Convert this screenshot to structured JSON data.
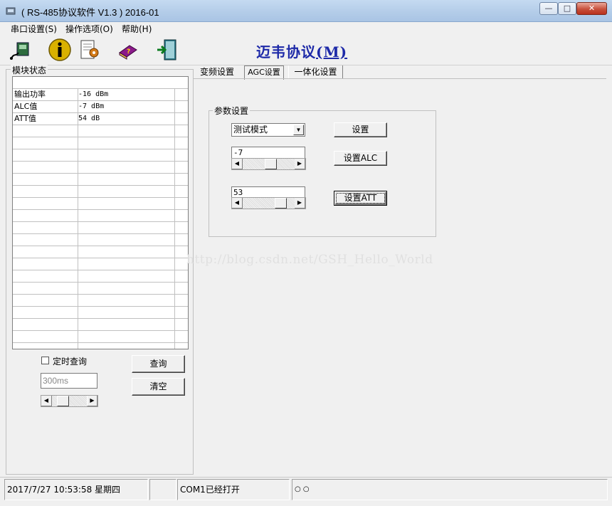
{
  "window": {
    "title": "( RS-485协议软件 V1.3 ) 2016-01",
    "minimize": "—",
    "maximize": "□",
    "close": "✕"
  },
  "menu": [
    "串口设置(S)",
    "操作选项(O)",
    "帮助(H)"
  ],
  "toolbar": {
    "icons": [
      "serial-port-icon",
      "info-icon",
      "settings-icon",
      "help-book-icon",
      "exit-door-icon"
    ],
    "brand": "迈韦协议",
    "brand_m": "(M)"
  },
  "module_status": {
    "title": "模块状态",
    "rows": [
      {
        "name": "输出功率",
        "value": "-16 dBm"
      },
      {
        "name": "ALC值",
        "value": "-7 dBm"
      },
      {
        "name": "ATT值",
        "value": "54 dB"
      }
    ],
    "timed_query_label": "定时查询",
    "timed_query_checked": false,
    "interval_value": "300ms",
    "query_button": "查询",
    "clear_button": "清空"
  },
  "tabs": [
    {
      "label": "变频设置",
      "active": false
    },
    {
      "label": "AGC设置",
      "active": true
    },
    {
      "label": "一体化设置",
      "active": false
    }
  ],
  "params": {
    "title": "参数设置",
    "mode_select": "测试模式",
    "set_button": "设置",
    "alc_value": "-7",
    "set_alc_button": "设置ALC",
    "att_value": "53",
    "set_att_button": "设置ATT"
  },
  "watermark": "http://blog.csdn.net/GSH_Hello_World",
  "status": {
    "datetime": "2017/7/27 10:53:58 星期四",
    "port": "COM1已经打开",
    "extra": "○ ○"
  }
}
